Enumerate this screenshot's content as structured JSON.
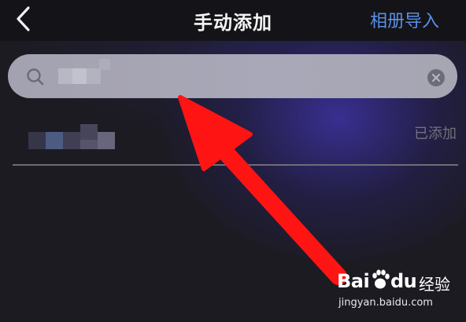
{
  "header": {
    "title": "手动添加",
    "right_action": "相册导入",
    "back_icon": "back-chevron-icon"
  },
  "search": {
    "icon": "search-icon",
    "value": "",
    "clear_icon": "clear-icon"
  },
  "contact": {
    "name": "",
    "status": "已添加"
  },
  "annotation": {
    "type": "red-arrow",
    "color": "#ff1414",
    "target": "search-bar"
  },
  "watermark": {
    "logo_left": "Bai",
    "logo_right": "du",
    "logo_suffix": "经验",
    "url": "jingyan.baidu.com"
  },
  "colors": {
    "background": "#1c1b22",
    "accent": "#5a8fe6",
    "arrow": "#ff1414"
  }
}
